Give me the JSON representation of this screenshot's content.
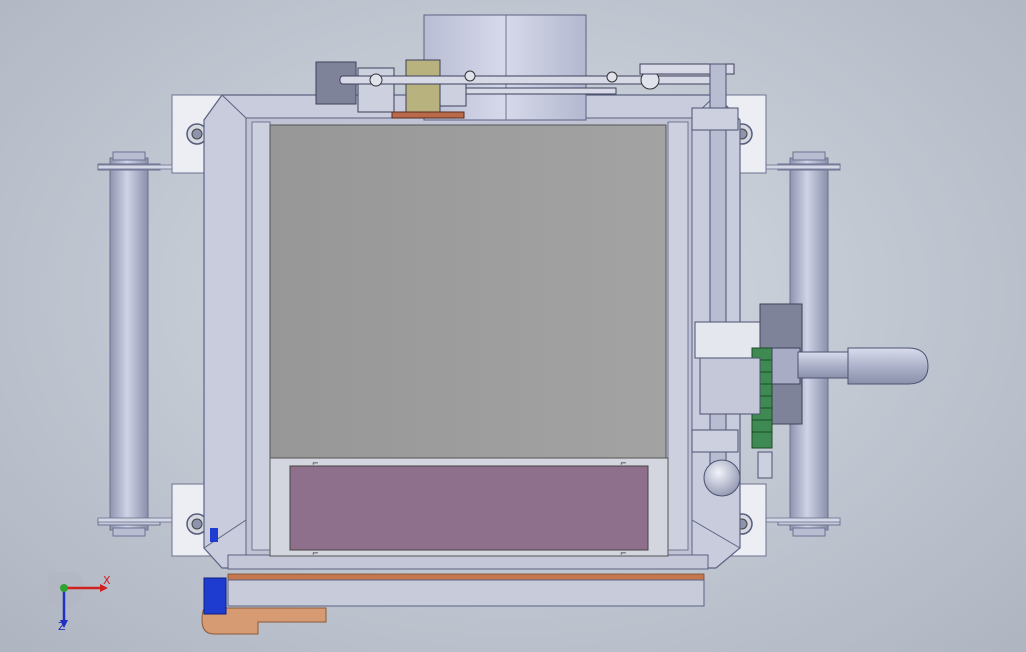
{
  "view": {
    "background": "#c9cfd8",
    "accent_steel": "#c4c8d6",
    "accent_panel": "#9a9a9a",
    "accent_window": "#8e6f8c",
    "accent_gear": "#3e8a52",
    "accent_wood": "#d79b73",
    "accent_blue": "#1e3ccf"
  },
  "triad": {
    "x_label": "X",
    "z_label": "Z",
    "x_color": "#d02020",
    "y_color": "#2ea32e",
    "z_color": "#2030c0"
  }
}
